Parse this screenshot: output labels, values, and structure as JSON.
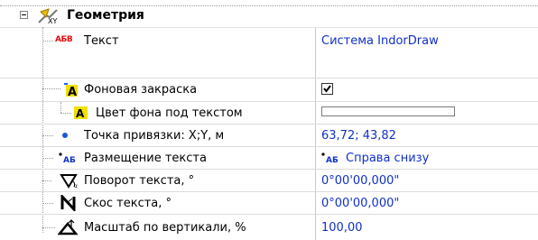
{
  "group": {
    "title": "Геометрия"
  },
  "rows": [
    {
      "name": "Текст",
      "value": "Система IndorDraw"
    },
    {
      "name": "Фоновая закраска",
      "checked": true
    },
    {
      "name": "Цвет фона под текстом"
    },
    {
      "name": "Точка привязки: X;Y, м",
      "value": "63,72; 43,82"
    },
    {
      "name": "Размещение текста",
      "value": "Справа снизу"
    },
    {
      "name": "Поворот текста, °",
      "value": "0°00'00,000\""
    },
    {
      "name": "Скос текста, °",
      "value": "0°00'00,000\""
    },
    {
      "name": "Масштаб по вертикали, %",
      "value": "100,00"
    }
  ],
  "icons": {
    "group": "geometry-xy-icon",
    "text": "abv-text-icon",
    "fill": "text-fill-icon",
    "bgcolor": "text-background-color-icon",
    "anchor": "anchor-point-icon",
    "placement": "text-placement-icon",
    "rotate": "text-rotate-icon",
    "skew": "text-skew-icon",
    "scale": "vertical-scale-icon"
  },
  "colors": {
    "value_text": "#1030c8",
    "icon_red": "#e01010",
    "icon_yellow": "#f0e000"
  }
}
